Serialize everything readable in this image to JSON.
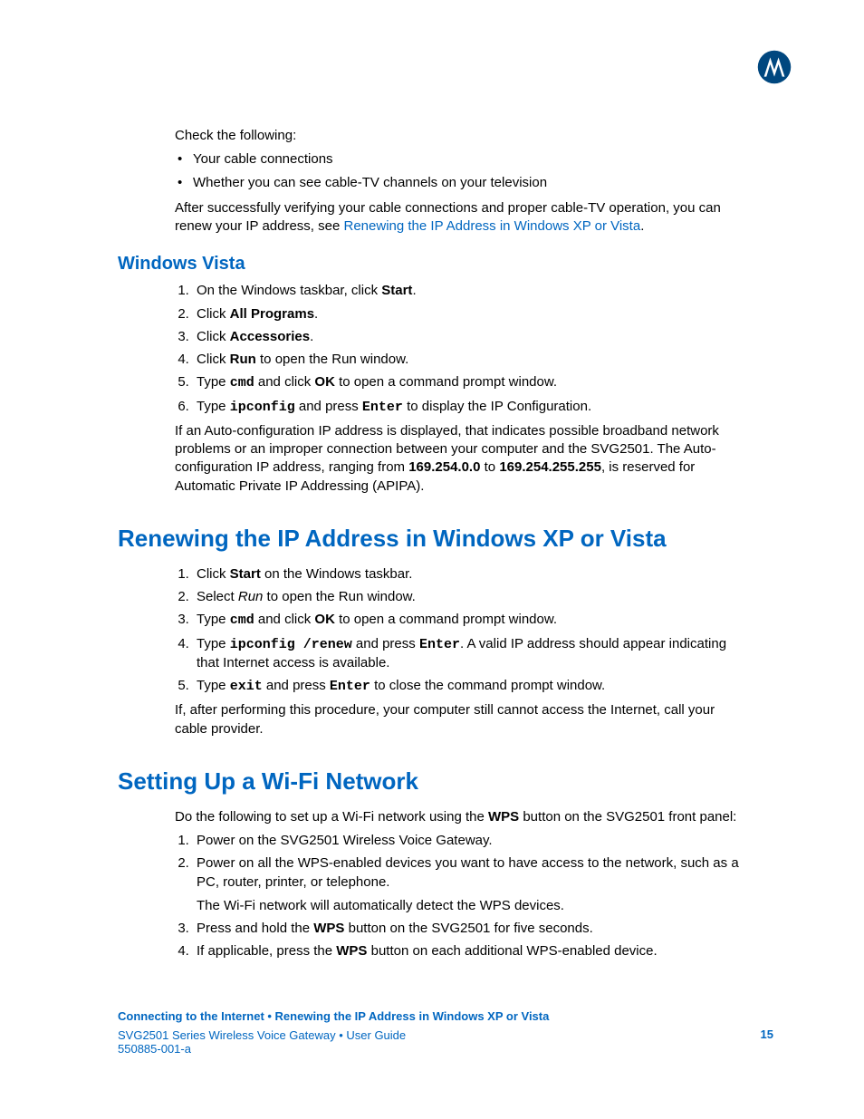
{
  "intro": {
    "check": "Check the following:",
    "bullet1": "Your cable connections",
    "bullet2": "Whether you can see cable-TV channels on your television",
    "after1": "After successfully verifying your cable connections and proper cable-TV operation, you can renew your IP address, see ",
    "afterLink": "Renewing the IP Address in Windows XP or Vista",
    "afterDot": "."
  },
  "vista": {
    "heading": "Windows Vista",
    "s1a": "On the Windows taskbar, click ",
    "s1b": "Start",
    "s1c": ".",
    "s2a": "Click ",
    "s2b": "All Programs",
    "s2c": ".",
    "s3a": "Click ",
    "s3b": "Accessories",
    "s3c": ".",
    "s4a": "Click ",
    "s4b": "Run",
    "s4c": " to open the Run window.",
    "s5a": "Type ",
    "s5b": "cmd",
    "s5c": " and click ",
    "s5d": "OK",
    "s5e": " to open a command prompt window.",
    "s6a": "Type ",
    "s6b": "ipconfig",
    "s6c": " and press ",
    "s6d": "Enter",
    "s6e": " to display the IP Configuration.",
    "p1": "If an Auto-configuration IP address is displayed, that indicates possible broadband network problems or an improper connection between your computer and the SVG2501. The Auto-configuration IP address, ranging from ",
    "ip1": "169.254.0.0",
    "p2": " to ",
    "ip2": "169.254.255.255",
    "p3": ", is reserved for Automatic Private IP Addressing (APIPA)."
  },
  "renew": {
    "heading": "Renewing the IP Address in Windows XP or Vista",
    "s1a": "Click ",
    "s1b": "Start",
    "s1c": " on the Windows taskbar.",
    "s2a": "Select ",
    "s2b": "Run",
    "s2c": " to open the Run window.",
    "s3a": "Type ",
    "s3b": "cmd",
    "s3c": " and click ",
    "s3d": "OK",
    "s3e": " to open a command prompt window.",
    "s4a": "Type ",
    "s4b": "ipconfig /renew",
    "s4c": " and press ",
    "s4d": "Enter",
    "s4e": ". A valid IP address should appear indicating that Internet access is available.",
    "s5a": "Type ",
    "s5b": "exit",
    "s5c": " and press ",
    "s5d": "Enter",
    "s5e": " to close the command prompt window.",
    "p1": "If, after performing this procedure, your computer still cannot access the Internet, call your cable provider."
  },
  "wifi": {
    "heading": "Setting Up a Wi-Fi Network",
    "intro1": "Do the following to set up a Wi-Fi network using the ",
    "intro2": "WPS",
    "intro3": " button on the SVG2501 front panel:",
    "s1": "Power on the SVG2501 Wireless Voice Gateway.",
    "s2": "Power on all the WPS-enabled devices you want to have access to the network, such as a PC, router, printer, or telephone.",
    "s2b": "The Wi-Fi network will automatically detect the WPS devices.",
    "s3a": "Press and hold the ",
    "s3b": "WPS",
    "s3c": " button on the SVG2501 for five seconds.",
    "s4a": "If applicable, press the ",
    "s4b": "WPS",
    "s4c": " button on each additional WPS-enabled device."
  },
  "footer": {
    "breadcrumb": "Connecting to the Internet • Renewing the IP Address in Windows XP or Vista",
    "meta": "SVG2501 Series Wireless Voice Gateway • User Guide",
    "docnum": "550885-001-a",
    "page": "15"
  }
}
